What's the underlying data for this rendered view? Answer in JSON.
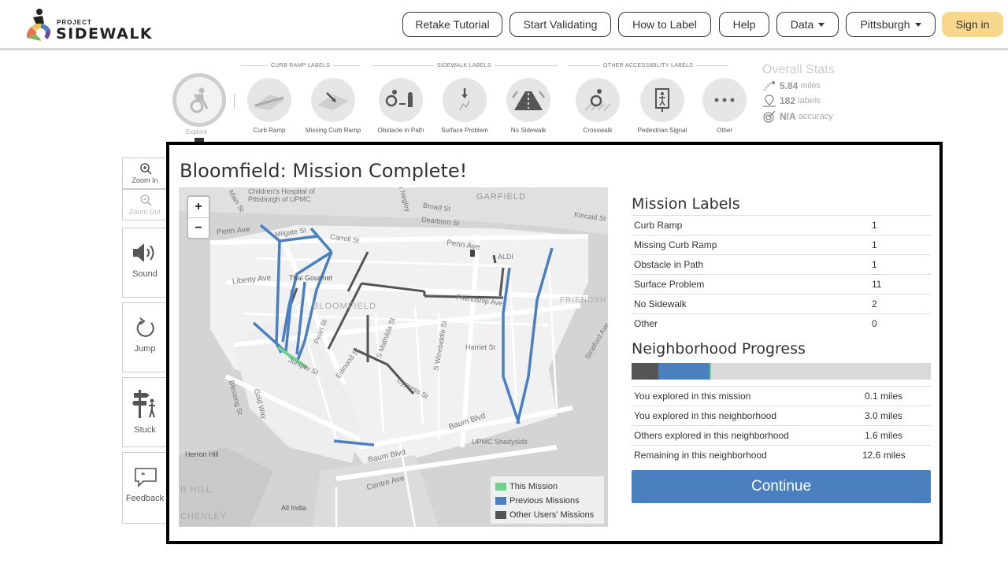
{
  "logo": {
    "small": "PROJECT",
    "big": "SIDEWALK"
  },
  "nav": {
    "retake": "Retake Tutorial",
    "validate": "Start Validating",
    "how": "How to Label",
    "help": "Help",
    "data": "Data",
    "city": "Pittsburgh",
    "signin": "Sign in"
  },
  "toolbar": {
    "sections": {
      "curb": "CURB RAMP LABELS",
      "sidewalk": "SIDEWALK LABELS",
      "other": "OTHER ACCESSIBILITY LABELS"
    },
    "explore": "Explore",
    "tools": [
      "Curb Ramp",
      "Missing Curb Ramp",
      "Obstacle in Path",
      "Surface Problem",
      "No Sidewalk",
      "Crosswalk",
      "Pedestrian Signal",
      "Other"
    ]
  },
  "stats": {
    "title": "Overall Stats",
    "miles_value": "5.84",
    "miles_unit": "miles",
    "labels_value": "182",
    "labels_unit": "labels",
    "accuracy_value": "N/A",
    "accuracy_unit": "accuracy"
  },
  "controls": {
    "zoom_in": "Zoom In",
    "zoom_out": "Zoom Out",
    "sound": "Sound",
    "jump": "Jump",
    "stuck": "Stuck",
    "feedback": "Feedback"
  },
  "modal": {
    "title": "Bloomfield: Mission Complete!",
    "map": {
      "zoom_in": "+",
      "zoom_out": "−",
      "places": [
        "Children's Hospital of",
        "Pittsburgh of UPMC",
        "GARFIELD",
        "Broad St",
        "Dearborn St",
        "Kincaid St",
        "Penn Ave",
        "Milgate St",
        "Carroll St",
        "Penn Ave",
        "ALDI",
        "Liberty Ave",
        "Thai Gourmet",
        "BLOOMFIELD",
        "Friendship Ave",
        "FRIENDSH",
        "Pearl St",
        "S Mathilda St",
        "S Winebiddle St",
        "Harriet St",
        "Stratford Ave",
        "Juniper St",
        "Edmond St",
        "Cypress St",
        "Blessing St",
        "Gold Way",
        "Baum Blvd",
        "UPMC Shadyside",
        "Herron Hill",
        "Baum Blvd",
        "Centre Ave",
        "R HILL",
        "All India",
        "CHENLEY",
        "Main St",
        "N Negley"
      ],
      "legend": [
        "This Mission",
        "Previous Missions",
        "Other Users' Missions"
      ],
      "colors": {
        "this": "#6ed38b",
        "previous": "#4a7fc0",
        "others": "#555555"
      }
    },
    "labels_title": "Mission Labels",
    "labels": [
      {
        "name": "Curb Ramp",
        "count": "1"
      },
      {
        "name": "Missing Curb Ramp",
        "count": "1"
      },
      {
        "name": "Obstacle in Path",
        "count": "1"
      },
      {
        "name": "Surface Problem",
        "count": "11"
      },
      {
        "name": "No Sidewalk",
        "count": "2"
      },
      {
        "name": "Other",
        "count": "0"
      }
    ],
    "progress_title": "Neighborhood Progress",
    "progress": {
      "others": 0.09,
      "previous": 0.17,
      "this": 0.006
    },
    "progress_rows": [
      {
        "name": "You explored in this mission",
        "value": "0.1 miles"
      },
      {
        "name": "You explored in this neighborhood",
        "value": "3.0 miles"
      },
      {
        "name": "Others explored in this neighborhood",
        "value": "1.6 miles"
      },
      {
        "name": "Remaining in this neighborhood",
        "value": "12.6 miles"
      }
    ],
    "continue": "Continue"
  }
}
